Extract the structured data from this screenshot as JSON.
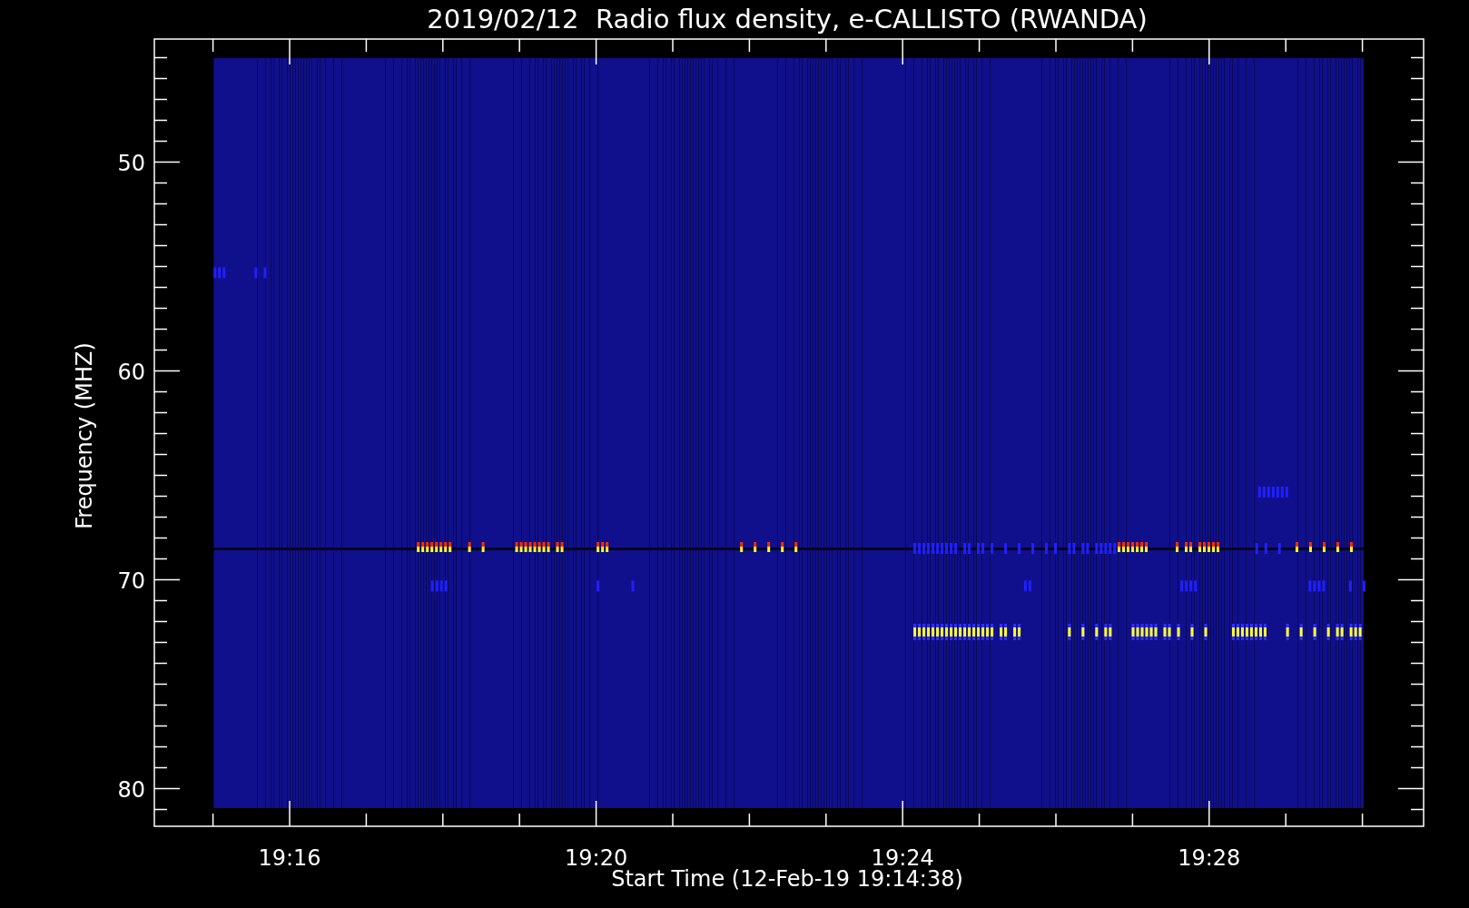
{
  "title": "2019/02/12  Radio flux density, e-CALLISTO (RWANDA)",
  "y_axis": {
    "label": "Frequency (MHZ)",
    "ticks": [
      "50",
      "60",
      "70",
      "80"
    ]
  },
  "x_axis": {
    "label": "Start Time (12-Feb-19 19:14:38)",
    "ticks": [
      "19:16",
      "19:20",
      "19:24",
      "19:28"
    ]
  }
}
